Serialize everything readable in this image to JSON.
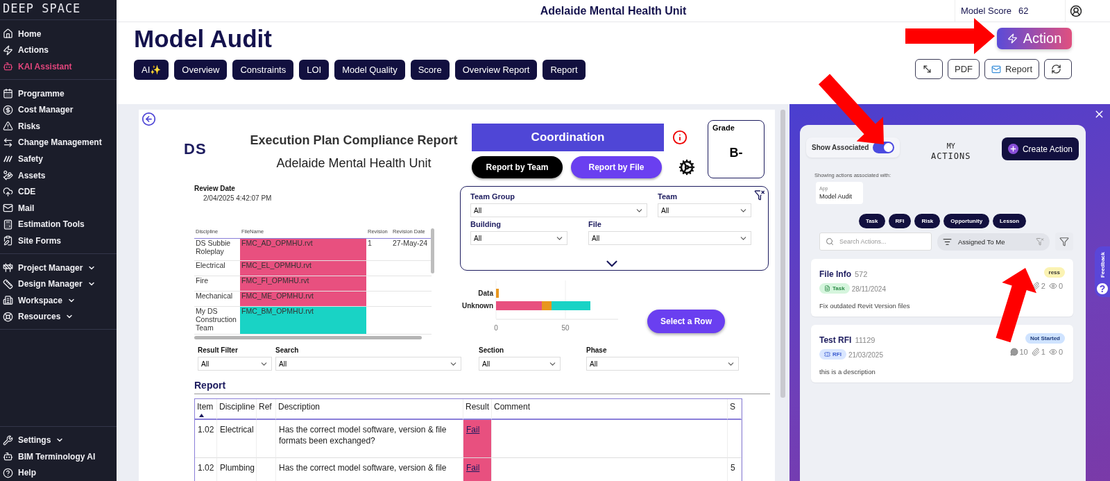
{
  "sidebar": {
    "logo": "DEEP SPACE",
    "groups": [
      {
        "items": [
          {
            "label": "Home",
            "selected": false,
            "expandable": false
          },
          {
            "label": "Actions",
            "selected": false,
            "expandable": false
          },
          {
            "label": "KAI Assistant",
            "selected": true,
            "expandable": false
          }
        ]
      },
      {
        "items": [
          {
            "label": "Programme",
            "selected": false,
            "expandable": false
          },
          {
            "label": "Cost Manager",
            "selected": false,
            "expandable": false
          },
          {
            "label": "Risks",
            "selected": false,
            "expandable": false
          },
          {
            "label": "Change Management",
            "selected": false,
            "expandable": false
          },
          {
            "label": "Safety",
            "selected": false,
            "expandable": false
          },
          {
            "label": "Assets",
            "selected": false,
            "expandable": false
          },
          {
            "label": "CDE",
            "selected": false,
            "expandable": false
          },
          {
            "label": "Mail",
            "selected": false,
            "expandable": false
          },
          {
            "label": "Estimation Tools",
            "selected": false,
            "expandable": false
          },
          {
            "label": "Site Forms",
            "selected": false,
            "expandable": false
          }
        ]
      },
      {
        "items": [
          {
            "label": "Project Manager",
            "selected": false,
            "expandable": true
          },
          {
            "label": "Design Manager",
            "selected": false,
            "expandable": true
          },
          {
            "label": "Workspace",
            "selected": false,
            "expandable": true
          },
          {
            "label": "Resources",
            "selected": false,
            "expandable": true
          }
        ]
      }
    ],
    "footer": [
      {
        "label": "Settings",
        "selected": false,
        "expandable": true
      },
      {
        "label": "BIM Terminology AI",
        "selected": false,
        "expandable": false
      },
      {
        "label": "Help",
        "selected": false,
        "expandable": false
      }
    ]
  },
  "topbar": {
    "title": "Adelaide Mental Health Unit",
    "score_label": "Model Score",
    "score_value": "62"
  },
  "header": {
    "title": "Model Audit",
    "tabs": [
      {
        "label": "AI✨"
      },
      {
        "label": "Overview"
      },
      {
        "label": "Constraints"
      },
      {
        "label": "LOI"
      },
      {
        "label": "Model Quality"
      },
      {
        "label": "Score"
      },
      {
        "label": "Overview Report"
      },
      {
        "label": "Report"
      }
    ],
    "action_button": "Action",
    "tools": [
      {
        "kind": "expand"
      },
      {
        "kind": "text",
        "label": "PDF"
      },
      {
        "kind": "mail",
        "label": "Report"
      },
      {
        "kind": "refresh"
      }
    ]
  },
  "report": {
    "logo": "DS",
    "title": "Execution Plan Compliance Report",
    "subtitle": "Adelaide Mental Health Unit",
    "banner": "Coordination",
    "view_buttons": [
      {
        "label": "Report by Team",
        "selected": false
      },
      {
        "label": "Report by File",
        "selected": true
      }
    ],
    "grade": {
      "label": "Grade",
      "value": "B-"
    },
    "review_date": {
      "label": "Review Date",
      "value": "2/04/2025 4:42:07 PM"
    },
    "files": {
      "columns": [
        "Discipline",
        "FileName",
        "Revision",
        "Revision Date"
      ],
      "rows": [
        {
          "discipline": "DS Subbie Roleplay",
          "file": "FMC_AD_OPMHU.rvt",
          "color": "#e8507f",
          "revision": "1",
          "date": "27-May-24"
        },
        {
          "discipline": "Electrical",
          "file": "FMC_EL_OPMHU.rvt",
          "color": "#e8507f"
        },
        {
          "discipline": "Fire",
          "file": "FMC_FI_OPMHU.rvt",
          "color": "#e8507f"
        },
        {
          "discipline": "Mechanical",
          "file": "FMC_ME_OPMHU.rvt",
          "color": "#e8507f"
        },
        {
          "discipline": "My DS Construction Team",
          "file": "FMC_BM_OPMHU.rvt",
          "color": "#19d3c5"
        }
      ]
    },
    "slicers": [
      {
        "label": "Team Group",
        "value": "All"
      },
      {
        "label": "Team",
        "value": "All"
      },
      {
        "label": "Building",
        "value": "All"
      },
      {
        "label": "File",
        "value": "All"
      }
    ],
    "chart_data": {
      "type": "bar",
      "orientation": "horizontal",
      "stacked": true,
      "categories": [
        "Data",
        "Unknown"
      ],
      "xlim": [
        0,
        88
      ],
      "xticks": [
        0,
        50
      ],
      "series": [
        {
          "color": "#e8507f",
          "values": [
            null,
            33
          ]
        },
        {
          "color": "#e8961e",
          "values": [
            2,
            7
          ]
        },
        {
          "color": "#19d3c5",
          "values": [
            null,
            28
          ]
        }
      ]
    },
    "select_button": "Select a Row",
    "filters": [
      {
        "label": "Result Filter",
        "value": "All"
      },
      {
        "label": "Search",
        "value": "All"
      },
      {
        "label": "Section",
        "value": "All"
      },
      {
        "label": "Phase",
        "value": "All"
      }
    ],
    "table": {
      "title": "Report",
      "columns": [
        "Item",
        "Discipline",
        "Ref",
        "Description",
        "Result",
        "Comment",
        "S"
      ],
      "rows": [
        {
          "cells": [
            "1.02",
            "Electrical",
            "",
            "Has the correct model software, version & file formats been exchanged?",
            "Fail",
            "",
            ""
          ],
          "color": "#e8507f"
        },
        {
          "cells": [
            "1.02",
            "Plumbing",
            "",
            "Has the correct model software, version & file",
            "Fail",
            "",
            "5"
          ],
          "color": "#e8507f"
        }
      ]
    }
  },
  "actions": {
    "show_associated": {
      "label": "Show Associated",
      "on": true
    },
    "title_top": "MY",
    "title_bottom": "ACTIONS",
    "create_button": "Create Action",
    "context_label": "Showing actions associated with:",
    "context": {
      "type": "App",
      "name": "Model Audit"
    },
    "types": [
      "Task",
      "RFI",
      "Risk",
      "Opportunity",
      "Lesson"
    ],
    "search": {
      "placeholder": "Search Actions..."
    },
    "assignee_filter": "Assigned To Me",
    "cards": [
      {
        "title": "File Info",
        "number": "572",
        "status": {
          "kind": "progress",
          "label": "ress"
        },
        "tag": {
          "kind": "task",
          "label": "Task"
        },
        "date": "28/11/2024",
        "counts": [
          {
            "kind": "attachments",
            "value": "2"
          },
          {
            "kind": "views",
            "value": "0"
          }
        ],
        "description": "Fix outdated Revit Version files"
      },
      {
        "title": "Test RFI",
        "number": "11129",
        "status": {
          "kind": "not_started",
          "label": "Not Started"
        },
        "tag": {
          "kind": "rfi",
          "label": "RFI"
        },
        "date": "21/03/2025",
        "counts": [
          {
            "kind": "comments",
            "value": "10"
          },
          {
            "kind": "attachments",
            "value": "1"
          },
          {
            "kind": "views",
            "value": "0"
          }
        ],
        "description": "this is a description"
      }
    ],
    "feedback": "Feedback",
    "help": "?"
  }
}
